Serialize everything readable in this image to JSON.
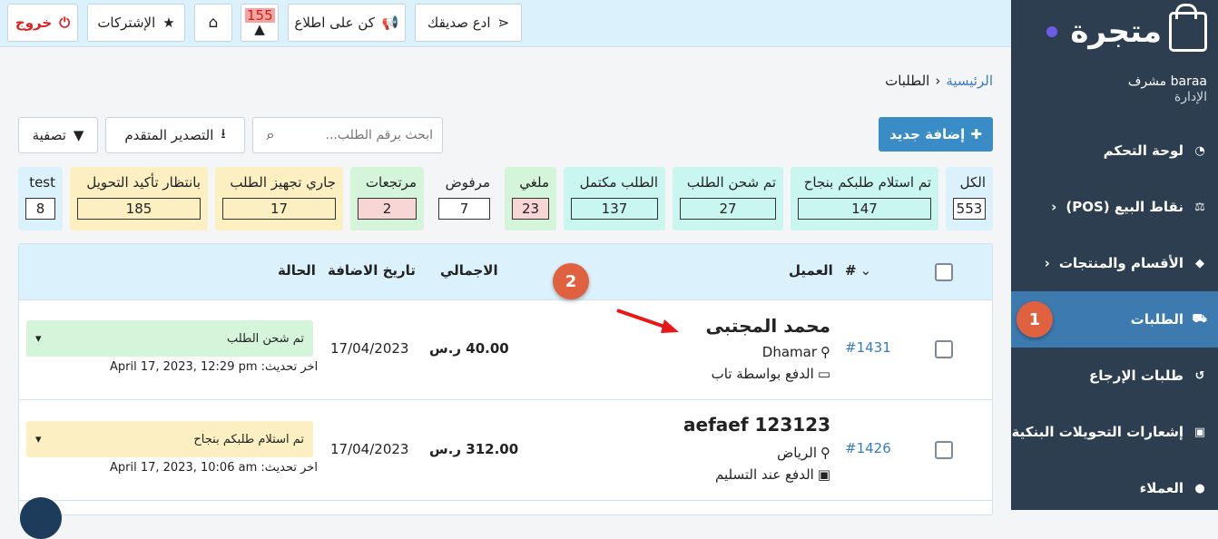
{
  "sidebar": {
    "logo_text": "متجرة",
    "user_name": "baraa مشرف",
    "user_role": "الإدارة",
    "items": [
      {
        "label": "لوحة التحكم",
        "icon": "dashboard-icon"
      },
      {
        "label": "نقاط البيع (POS)",
        "icon": "scale-icon"
      },
      {
        "label": "الأقسام والمنتجات",
        "icon": "tag-icon"
      },
      {
        "label": "الطلبات",
        "icon": "cart-icon"
      },
      {
        "label": "طلبات الإرجاع",
        "icon": "undo-icon"
      },
      {
        "label": "إشعارات التحويلات البنكية",
        "icon": "money-icon"
      },
      {
        "label": "العملاء",
        "icon": "user-icon"
      }
    ],
    "marker": "1"
  },
  "topbar": {
    "logout": "خروج",
    "subscriptions": "الإشتركات",
    "notifications_count": "155",
    "stay_informed": "كن على اطلاع",
    "invite_friend": "ادع صديقك"
  },
  "breadcrumb": {
    "home": "الرئيسية",
    "current": "الطلبات"
  },
  "toolbar": {
    "add_new": "إضافة جديد",
    "search_placeholder": "ابحث برقم الطلب...",
    "advanced_export": "التصدير المتقدم",
    "filter": "تصفية"
  },
  "status_cards": [
    {
      "label": "الكل",
      "count": "553"
    },
    {
      "label": "تم استلام طلبكم بنجاح",
      "count": "147"
    },
    {
      "label": "تم شحن الطلب",
      "count": "27"
    },
    {
      "label": "الطلب مكتمل",
      "count": "137"
    },
    {
      "label": "ملغي",
      "count": "23"
    },
    {
      "label": "مرفوض",
      "count": "7"
    },
    {
      "label": "مرتجعات",
      "count": "2"
    },
    {
      "label": "جاري تجهيز الطلب",
      "count": "17"
    },
    {
      "label": "بانتظار تأكيد التحويل",
      "count": "185"
    },
    {
      "label": "test",
      "count": "8"
    }
  ],
  "table": {
    "headers": {
      "number": "#",
      "customer": "العميل",
      "total": "الاجمالي",
      "date_added": "تاريخ الاضافة",
      "status": "الحالة"
    },
    "marker": "2",
    "rows": [
      {
        "id": "#1431",
        "customer": "محمد المجتبى",
        "city": "Dhamar",
        "payment": "الدفع بواسطة تاب",
        "total": "40.00 ر.س",
        "date": "17/04/2023",
        "status": "تم شحن الطلب",
        "last_update_label": "اخر تحديث:",
        "last_update": "April 17, 2023, 12:29 pm"
      },
      {
        "id": "#1426",
        "customer": "aefaef 123123",
        "city": "الرياض",
        "payment": "الدفع عند التسليم",
        "total": "312.00 ر.س",
        "date": "17/04/2023",
        "status": "تم استلام طلبكم بنجاح",
        "last_update_label": "اخر تحديث:",
        "last_update": "April 17, 2023, 10:06 am"
      }
    ]
  },
  "colors": {
    "sidebar": "#2c3e50",
    "sidebar_active": "#3d7ab0",
    "topbar": "#dbf1fb",
    "accent": "#3a8cc6",
    "marker": "#e0613f"
  }
}
